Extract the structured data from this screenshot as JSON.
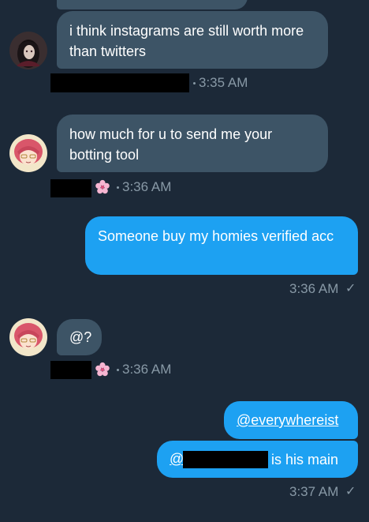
{
  "messages": [
    {
      "text": "i think instagrams are still worth more than twitters",
      "time": "3:35 AM"
    },
    {
      "text": "how much for u to send me your botting tool",
      "time": "3:36 AM"
    },
    {
      "text": "Someone buy my homies verified acc",
      "time": "3:36 AM"
    },
    {
      "text": "@?",
      "time": "3:36 AM"
    },
    {
      "text": "@everywhereist"
    },
    {
      "prefix": "@",
      "suffix": "is his main",
      "time": "3:37 AM"
    }
  ],
  "icons": {
    "flower": "cherry-blossom-icon",
    "read": "checkmark-icon"
  },
  "colors": {
    "background": "#1c2938",
    "incoming_bubble": "#3d5466",
    "outgoing_bubble": "#1da1f2",
    "meta_text": "#8899a6"
  }
}
